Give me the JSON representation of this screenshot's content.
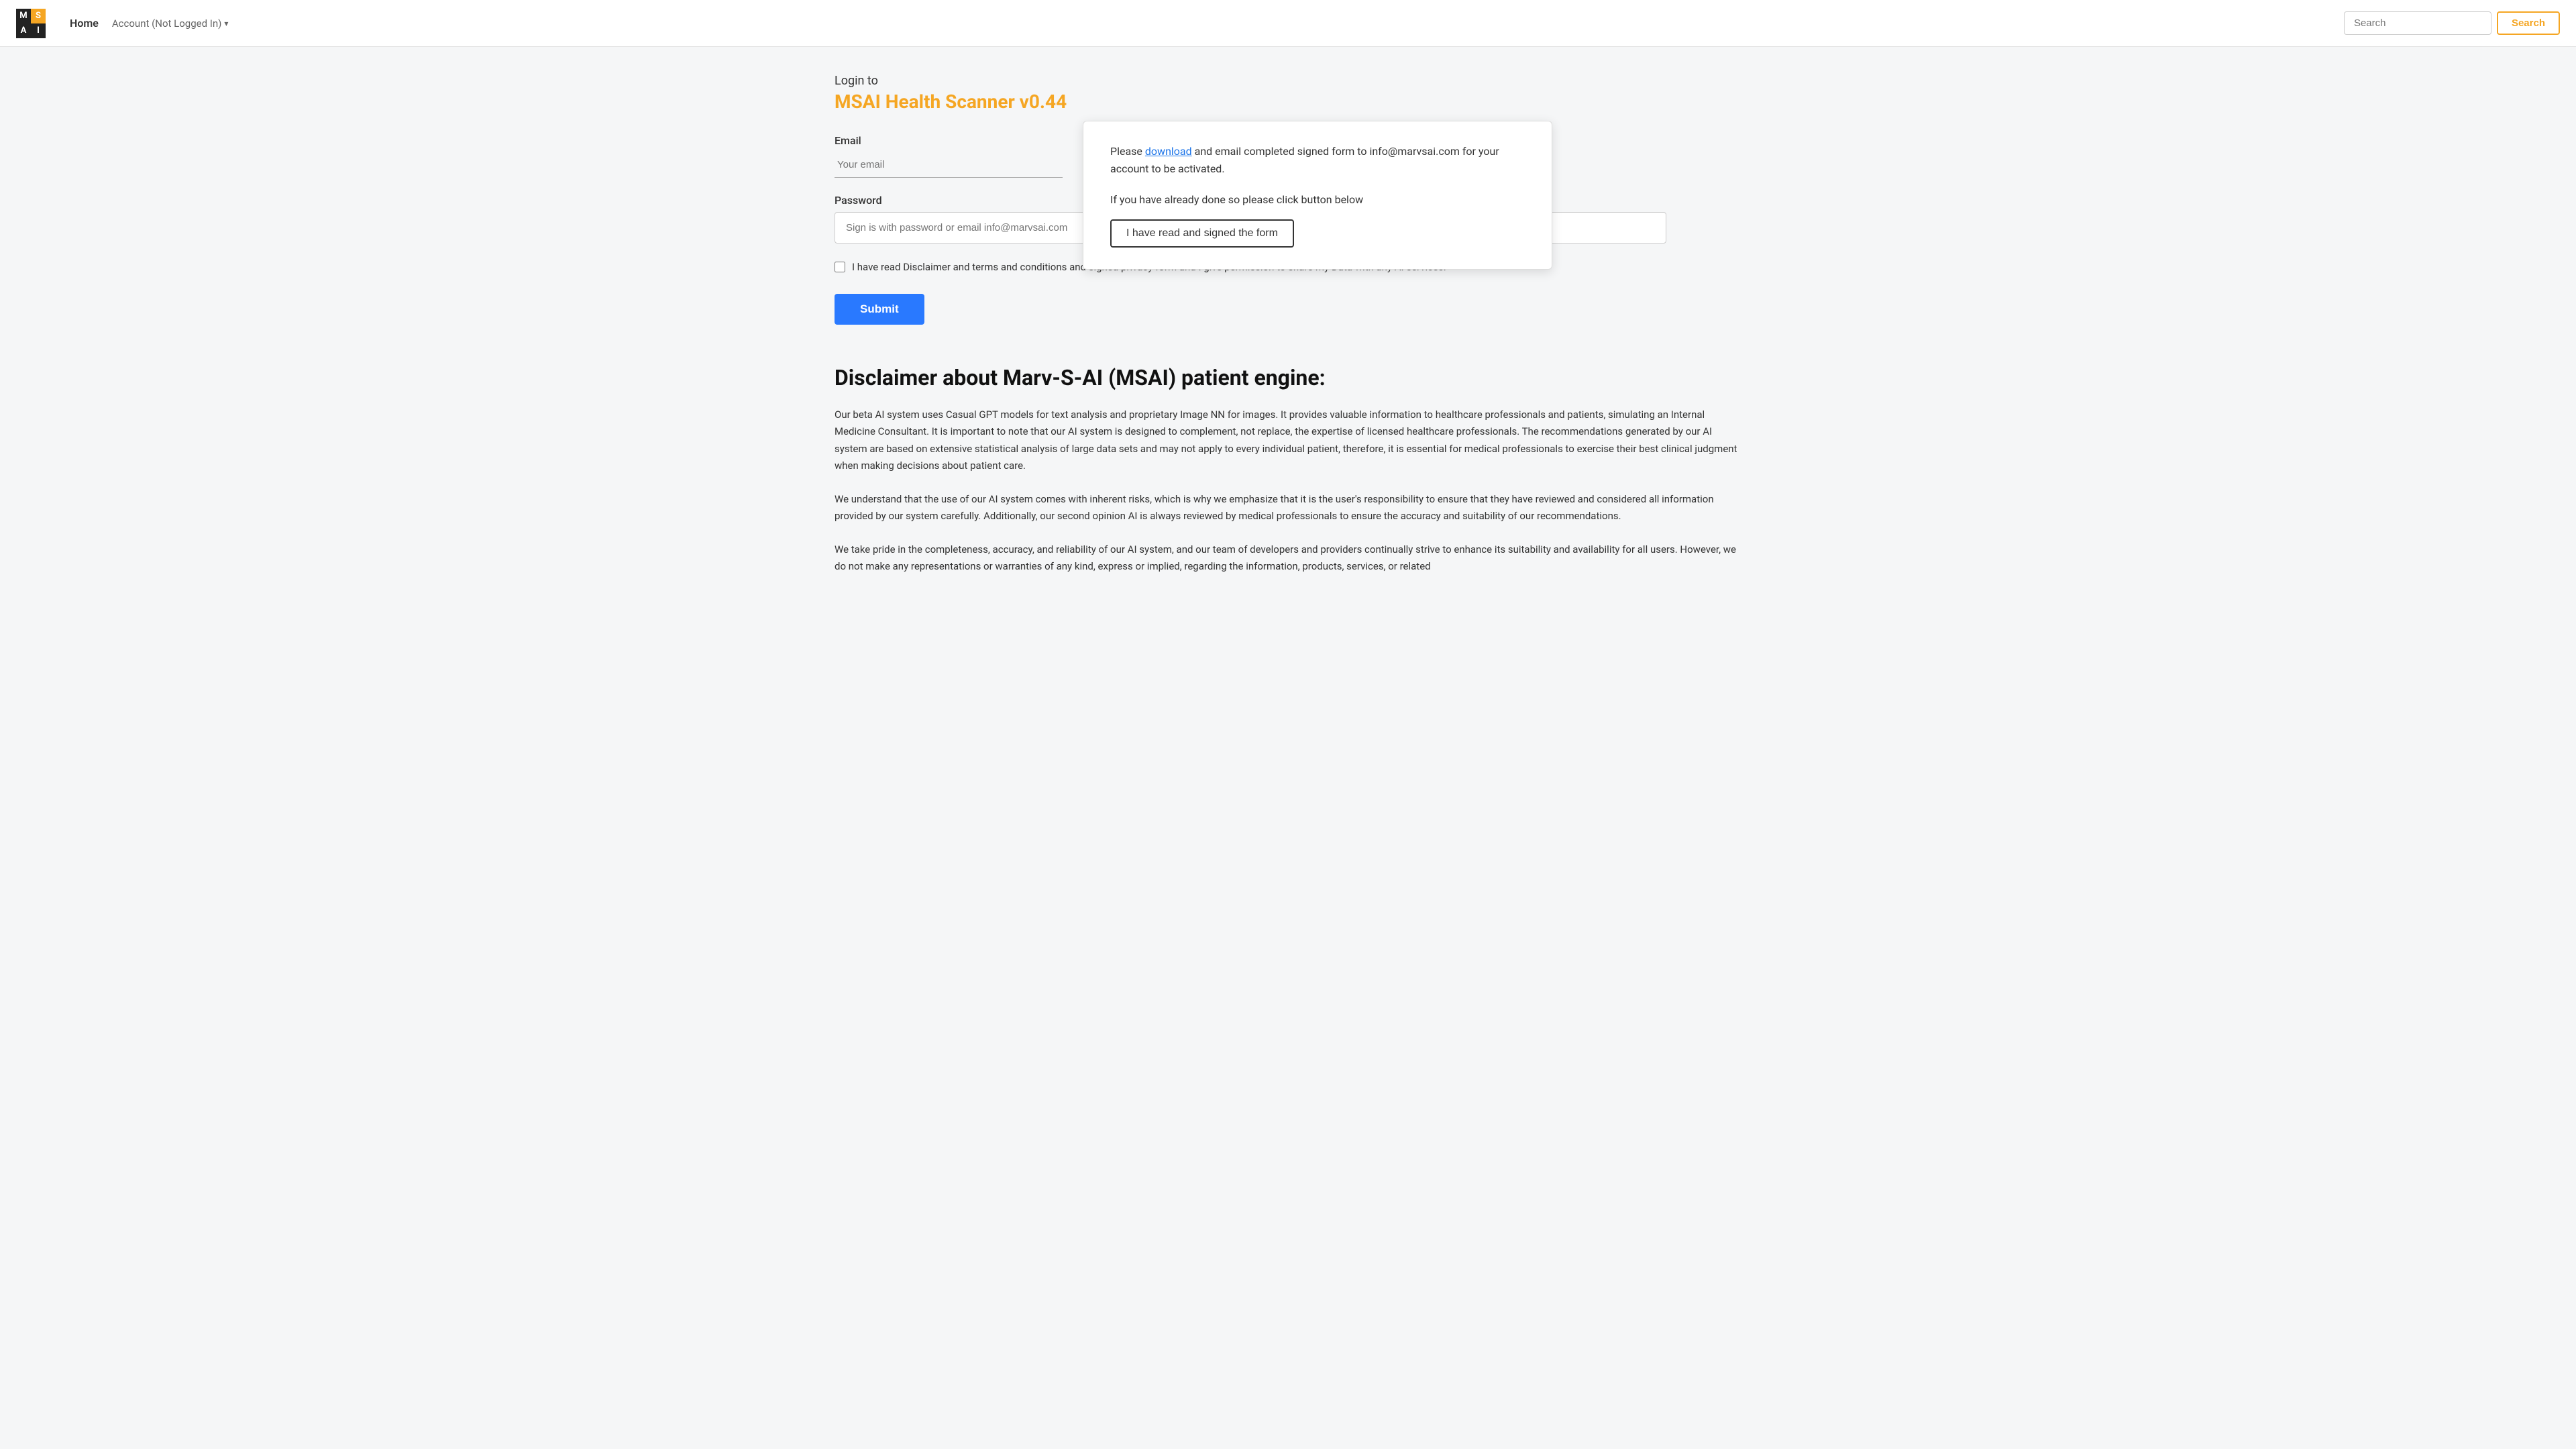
{
  "navbar": {
    "logo": {
      "cells": [
        {
          "letter": "M",
          "type": "dark"
        },
        {
          "letter": "S",
          "type": "orange"
        },
        {
          "letter": "A",
          "type": "dark"
        },
        {
          "letter": "I",
          "type": "dark"
        }
      ]
    },
    "links": [
      {
        "label": "Home",
        "active": true
      },
      {
        "label": "Account (Not Logged In)",
        "active": false,
        "hasDropdown": true
      }
    ],
    "search": {
      "placeholder": "Search",
      "button_label": "Search"
    }
  },
  "login": {
    "prefix_label": "Login to",
    "app_title": "MSAI Health Scanner v0.44"
  },
  "popup": {
    "text_before_link": "Please ",
    "link_text": "download",
    "text_after_link": " and email completed signed form to info@marvsai.com for your account to be activated.",
    "subtitle": "If you have already done so please click button below",
    "button_label": "I have read and signed the form"
  },
  "form": {
    "email_label": "Email",
    "email_placeholder": "Your email",
    "password_label": "Password",
    "password_placeholder": "Sign is with password or email info@marvsai.com",
    "checkbox_label": "I have read Disclaimer and terms and conditions and signed privacy form and I give permission to share my Data with any AI services.",
    "submit_label": "Submit"
  },
  "disclaimer": {
    "title": "Disclaimer about Marv-S-AI (MSAI) patient engine:",
    "paragraphs": [
      "Our beta AI system uses Casual GPT models for text analysis and proprietary Image NN for images. It provides valuable information to healthcare professionals and patients, simulating an Internal Medicine Consultant. It is important to note that our AI system is designed to complement, not replace, the expertise of licensed healthcare professionals. The recommendations generated by our AI system are based on extensive statistical analysis of large data sets and may not apply to every individual patient, therefore, it is essential for medical professionals to exercise their best clinical judgment when making decisions about patient care.",
      "We understand that the use of our AI system comes with inherent risks, which is why we emphasize that it is the user's responsibility to ensure that they have reviewed and considered all information provided by our system carefully. Additionally, our second opinion AI is always reviewed by medical professionals to ensure the accuracy and suitability of our recommendations.",
      "We take pride in the completeness, accuracy, and reliability of our AI system, and our team of developers and providers continually strive to enhance its suitability and availability for all users. However, we do not make any representations or warranties of any kind, express or implied, regarding the information, products, services, or related"
    ]
  }
}
